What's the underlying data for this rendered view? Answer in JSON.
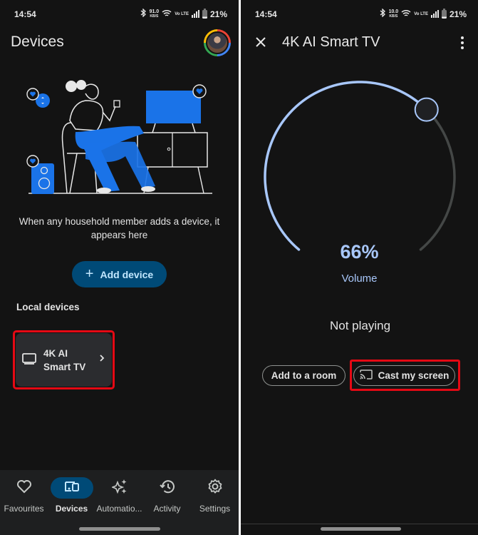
{
  "left_screen": {
    "status_bar": {
      "time": "14:54",
      "net_speed_value": "91.0",
      "net_speed_unit": "KB/S",
      "volte": "Vo LTE",
      "battery": "21%"
    },
    "header": {
      "title": "Devices",
      "avatar_label": "Account avatar"
    },
    "empty_state": {
      "message": "When any household member adds a device, it appears here",
      "add_button_label": "Add device"
    },
    "local_devices": {
      "section_label": "Local devices",
      "items": [
        {
          "name": "4K AI Smart TV",
          "icon": "tv-icon",
          "highlighted": true
        }
      ]
    },
    "bottom_nav": {
      "items": [
        {
          "label": "Favourites",
          "icon": "heart-icon",
          "active": false
        },
        {
          "label": "Devices",
          "icon": "devices-icon",
          "active": true
        },
        {
          "label": "Automatio...",
          "icon": "sparkle-icon",
          "active": false
        },
        {
          "label": "Activity",
          "icon": "history-icon",
          "active": false
        },
        {
          "label": "Settings",
          "icon": "gear-icon",
          "active": false
        }
      ]
    }
  },
  "right_screen": {
    "status_bar": {
      "time": "14:54",
      "net_speed_value": "10.0",
      "net_speed_unit": "KB/S",
      "volte": "Vo LTE",
      "battery": "21%"
    },
    "header": {
      "title": "4K AI Smart TV"
    },
    "volume": {
      "value_percent": 66,
      "display": "66%",
      "label": "Volume"
    },
    "playback_status": "Not playing",
    "actions": {
      "add_to_room_label": "Add to a room",
      "cast_screen_label": "Cast my screen",
      "cast_highlighted": true
    }
  },
  "colors": {
    "background": "#131313",
    "accent_blue": "#a8c7fa",
    "button_fill": "#004a77",
    "button_text": "#c2e7ff",
    "card": "#2b2c2f",
    "highlight_red": "#e50914",
    "track_inactive": "#444746",
    "illustration_blue": "#1a73e8"
  }
}
